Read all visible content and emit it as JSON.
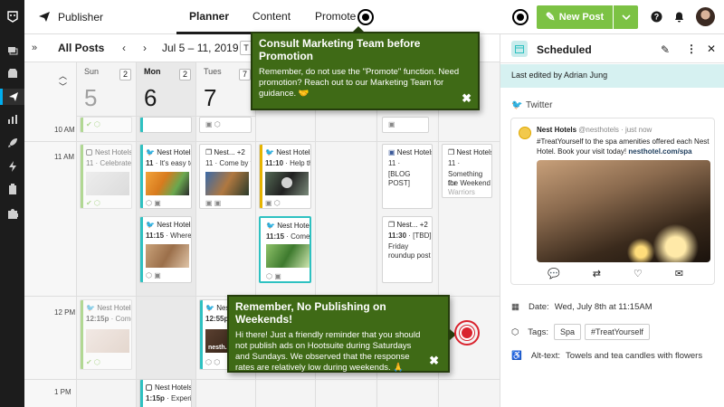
{
  "header": {
    "app_title": "Publisher",
    "tabs": [
      "Planner",
      "Content",
      "Promote"
    ],
    "new_post_label": "New Post"
  },
  "calendar": {
    "collapse": "»",
    "title": "All Posts",
    "date_range": "Jul 5 – 11, 2019",
    "today_badge": "T",
    "days": [
      {
        "name": "Sun",
        "num": "5",
        "count": "2"
      },
      {
        "name": "Mon",
        "num": "6",
        "count": "2"
      },
      {
        "name": "Tues",
        "num": "7",
        "count": "7"
      }
    ],
    "hours": [
      "10 AM",
      "11 AM",
      "12 PM",
      "1 PM"
    ],
    "posts": {
      "sun_11": {
        "net": "Nest Hotels",
        "time": "11",
        "text": "Celebrate t"
      },
      "mon_11a": {
        "net": "Nest Hotels",
        "time": "11",
        "text": "It's easy to"
      },
      "mon_11b": {
        "net": "Nest Hotels",
        "time": "11:15",
        "text": "Where d"
      },
      "tue_11": {
        "net": "Nest... +2",
        "time": "11",
        "text": "Come by t"
      },
      "wed_11a": {
        "net": "Nest Hotels",
        "time": "11:10",
        "text": "Help th"
      },
      "wed_11b": {
        "net": "Nest Hotels",
        "time": "11:15",
        "text": "Come re"
      },
      "thu_11a": {
        "net": "Nest Hotels",
        "time": "11",
        "text": "[BLOG POST]"
      },
      "thu_11b": {
        "net": "Nest... +2",
        "time": "11:30",
        "text": "[TBD]",
        "line2": "Friday",
        "line3": "roundup post"
      },
      "fri_11": {
        "net": "Nest Hotels",
        "time": "11",
        "text": "Something for",
        "line2": "the Weekend",
        "line3": "Warriors"
      },
      "sun_12": {
        "net": "Nest Hotels",
        "time": "12:15p",
        "text": "Come c"
      },
      "tue_12": {
        "net": "Nest Hotels",
        "time": "12:55p",
        "text": "",
        "img_label": "nesth..."
      },
      "mon_1": {
        "net": "Nest Hotels",
        "time": "1:15p",
        "text": "Experien"
      }
    }
  },
  "tips": {
    "promo": {
      "title": "Consult Marketing Team before Promotion",
      "body": "Remember, do not use the \"Promote\" function. Need promotion? Reach out to our Marketing Team for guidance. 🤝",
      "close": "✖"
    },
    "weekend": {
      "title": "Remember, No Publishing on Weekends!",
      "body": "Hi there! Just a friendly reminder that you should not publish ads on Hootsuite during Saturdays and Sundays. We observed that the response rates are relatively low during weekends. 🙏",
      "close": "✖"
    }
  },
  "panel": {
    "title": "Scheduled",
    "last_edited": "Last edited by Adrian Jung",
    "network_label": "Twitter",
    "tweet": {
      "name": "Nest Hotels",
      "handle": "@nesthotels · just now",
      "text": "#TreatYourself to the spa amenities offered each Nest Hotel. Book your visit today!",
      "link": "nesthotel.com/spa"
    },
    "date_label": "Date:",
    "date_value": "Wed, July 8th at 11:15AM",
    "tags_label": "Tags:",
    "tags": [
      "Spa",
      "#TreatYourself"
    ],
    "alt_label": "Alt-text:",
    "alt_value": "Towels and tea candles with flowers"
  },
  "colors": {
    "nav_bg": "#1c1c1c",
    "accent_green": "#7cc244",
    "tip_green": "#3f6a16",
    "teal": "#2ec1c1",
    "alert_red": "#d9232e"
  }
}
